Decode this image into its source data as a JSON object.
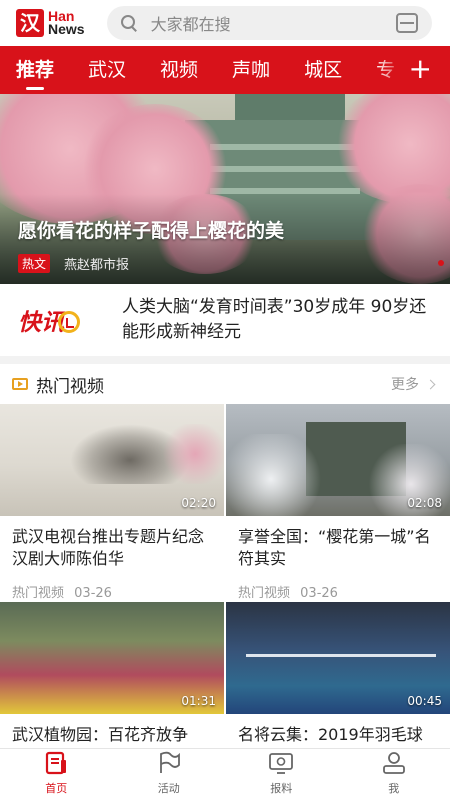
{
  "header": {
    "logo_mark": "汉",
    "logo_line1": "Han",
    "logo_line2": "News",
    "search_placeholder": "大家都在搜"
  },
  "channels": [
    "推荐",
    "武汉",
    "视频",
    "声咖",
    "城区",
    "专"
  ],
  "hero": {
    "title": "愿你看花的样子配得上樱花的美",
    "tag": "热文",
    "source": "燕赵都市报"
  },
  "flash": {
    "logo_text": "快讯",
    "text": "人类大脑“发育时间表”30岁成年 90岁还能形成新神经元"
  },
  "hot_videos": {
    "title": "热门视频",
    "more": "更多",
    "items": [
      {
        "title": "武汉电视台推出专题片纪念汉剧大师陈伯华",
        "duration": "02:20",
        "category": "热门视频",
        "date": "03-26"
      },
      {
        "title": "享誉全国：“樱花第一城”名符其实",
        "duration": "02:08",
        "category": "热门视频",
        "date": "03-26"
      },
      {
        "title": "武汉植物园：百花齐放争",
        "duration": "01:31"
      },
      {
        "title": "名将云集：2019年羽毛球",
        "duration": "00:45"
      }
    ]
  },
  "tabbar": [
    {
      "label": "首页",
      "icon": "home-icon"
    },
    {
      "label": "活动",
      "icon": "flag-icon"
    },
    {
      "label": "报料",
      "icon": "report-icon"
    },
    {
      "label": "我",
      "icon": "user-icon"
    }
  ],
  "colors": {
    "brand_red": "#d8121a",
    "section_icon": "#e7a020"
  }
}
